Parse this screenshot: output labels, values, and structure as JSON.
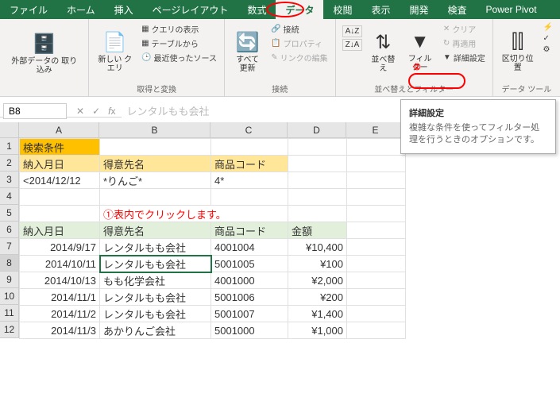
{
  "tabs": [
    "ファイル",
    "ホーム",
    "挿入",
    "ページレイアウト",
    "数式",
    "データ",
    "校閲",
    "表示",
    "開発",
    "検査",
    "Power Pivot"
  ],
  "active_tab": "データ",
  "ribbon": {
    "group1": {
      "label": "取得と変換",
      "btn_external": "外部データの\n取り込み",
      "btn_newquery": "新しい\nクエリ",
      "q1": "クエリの表示",
      "q2": "テーブルから",
      "q3": "最近使ったソース"
    },
    "group2": {
      "label": "接続",
      "btn_refresh": "すべて\n更新",
      "c1": "接続",
      "c2": "プロパティ",
      "c3": "リンクの編集"
    },
    "group3": {
      "label": "並べ替えとフィルター",
      "btn_sort": "並べ替え",
      "btn_filter": "フィルター",
      "f1": "クリア",
      "f2": "再適用",
      "f3": "詳細設定"
    },
    "group4": {
      "label": "データ ツール",
      "btn_split": "区切り位置"
    }
  },
  "badge2": "②",
  "tooltip": {
    "title": "詳細設定",
    "desc": "複雑な条件を使ってフィルター処理を行うときのオプションです。"
  },
  "namebox": "B8",
  "formula": "レンタルもも会社",
  "cols": [
    "A",
    "B",
    "C",
    "D",
    "E"
  ],
  "rows": [
    "1",
    "2",
    "3",
    "4",
    "5",
    "6",
    "7",
    "8",
    "9",
    "10",
    "11",
    "12"
  ],
  "cells": {
    "A1": "検索条件",
    "A2": "納入月日",
    "B2": "得意先名",
    "C2": "商品コード",
    "A3": "<2014/12/12",
    "B3": "*りんご*",
    "C3": "4*",
    "B5": "①表内でクリックします。",
    "A6": "納入月日",
    "B6": "得意先名",
    "C6": "商品コード",
    "D6": "金額",
    "A7": "2014/9/17",
    "B7": "レンタルもも会社",
    "C7": "4001004",
    "D7": "¥10,400",
    "A8": "2014/10/11",
    "B8": "レンタルもも会社",
    "C8": "5001005",
    "D8": "¥100",
    "A9": "2014/10/13",
    "B9": "もも化学会社",
    "C9": "4001000",
    "D9": "¥2,000",
    "A10": "2014/11/1",
    "B10": "レンタルもも会社",
    "C10": "5001006",
    "D10": "¥200",
    "A11": "2014/11/2",
    "B11": "レンタルもも会社",
    "C11": "5001007",
    "D11": "¥1,400",
    "A12": "2014/11/3",
    "B12": "あかりんご会社",
    "C12": "5001000",
    "D12": "¥1,000"
  }
}
